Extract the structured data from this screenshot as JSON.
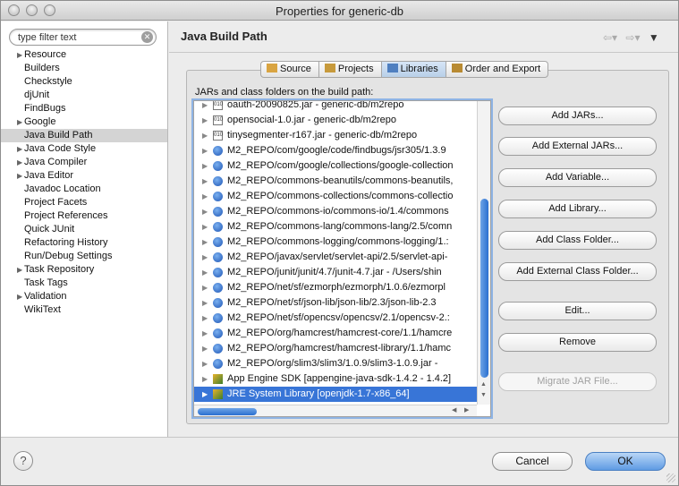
{
  "window": {
    "title": "Properties for generic-db"
  },
  "filter": {
    "placeholder": "type filter text",
    "value": "type filter text"
  },
  "tree": [
    {
      "label": "Resource",
      "expandable": true
    },
    {
      "label": "Builders",
      "expandable": false
    },
    {
      "label": "Checkstyle",
      "expandable": false
    },
    {
      "label": "djUnit",
      "expandable": false
    },
    {
      "label": "FindBugs",
      "expandable": false
    },
    {
      "label": "Google",
      "expandable": true
    },
    {
      "label": "Java Build Path",
      "expandable": false,
      "selected": true
    },
    {
      "label": "Java Code Style",
      "expandable": true
    },
    {
      "label": "Java Compiler",
      "expandable": true
    },
    {
      "label": "Java Editor",
      "expandable": true
    },
    {
      "label": "Javadoc Location",
      "expandable": false
    },
    {
      "label": "Project Facets",
      "expandable": false
    },
    {
      "label": "Project References",
      "expandable": false
    },
    {
      "label": "Quick JUnit",
      "expandable": false
    },
    {
      "label": "Refactoring History",
      "expandable": false
    },
    {
      "label": "Run/Debug Settings",
      "expandable": false
    },
    {
      "label": "Task Repository",
      "expandable": true
    },
    {
      "label": "Task Tags",
      "expandable": false
    },
    {
      "label": "Validation",
      "expandable": true
    },
    {
      "label": "WikiText",
      "expandable": false
    }
  ],
  "page": {
    "title": "Java Build Path"
  },
  "tabs": [
    {
      "label": "Source",
      "icon": "source-folder-icon"
    },
    {
      "label": "Projects",
      "icon": "projects-icon"
    },
    {
      "label": "Libraries",
      "icon": "libraries-icon",
      "active": true
    },
    {
      "label": "Order and Export",
      "icon": "order-export-icon"
    }
  ],
  "libraries": {
    "label": "JARs and class folders on the build path:",
    "items": [
      {
        "text": "oauth-20090825.jar - generic-db/m2repo",
        "icon": "jar"
      },
      {
        "text": "opensocial-1.0.jar - generic-db/m2repo",
        "icon": "jar"
      },
      {
        "text": "tinysegmenter-r167.jar - generic-db/m2repo",
        "icon": "jar"
      },
      {
        "text": "M2_REPO/com/google/code/findbugs/jsr305/1.3.9",
        "icon": "lib"
      },
      {
        "text": "M2_REPO/com/google/collections/google-collection",
        "icon": "lib"
      },
      {
        "text": "M2_REPO/commons-beanutils/commons-beanutils,",
        "icon": "lib"
      },
      {
        "text": "M2_REPO/commons-collections/commons-collectio",
        "icon": "lib"
      },
      {
        "text": "M2_REPO/commons-io/commons-io/1.4/commons",
        "icon": "lib"
      },
      {
        "text": "M2_REPO/commons-lang/commons-lang/2.5/comn",
        "icon": "lib"
      },
      {
        "text": "M2_REPO/commons-logging/commons-logging/1.:",
        "icon": "lib"
      },
      {
        "text": "M2_REPO/javax/servlet/servlet-api/2.5/servlet-api-",
        "icon": "lib"
      },
      {
        "text": "M2_REPO/junit/junit/4.7/junit-4.7.jar - /Users/shin",
        "icon": "lib"
      },
      {
        "text": "M2_REPO/net/sf/ezmorph/ezmorph/1.0.6/ezmorpl",
        "icon": "lib"
      },
      {
        "text": "M2_REPO/net/sf/json-lib/json-lib/2.3/json-lib-2.3",
        "icon": "lib"
      },
      {
        "text": "M2_REPO/net/sf/opencsv/opencsv/2.1/opencsv-2.:",
        "icon": "lib"
      },
      {
        "text": "M2_REPO/org/hamcrest/hamcrest-core/1.1/hamcre",
        "icon": "lib"
      },
      {
        "text": "M2_REPO/org/hamcrest/hamcrest-library/1.1/hamc",
        "icon": "lib"
      },
      {
        "text": "M2_REPO/org/slim3/slim3/1.0.9/slim3-1.0.9.jar -",
        "icon": "lib"
      },
      {
        "text": "App Engine SDK [appengine-java-sdk-1.4.2 - 1.4.2]",
        "icon": "sdk"
      },
      {
        "text": "JRE System Library [openjdk-1.7-x86_64]",
        "icon": "sdk",
        "selected": true
      }
    ]
  },
  "buttons": {
    "add_jars": "Add JARs...",
    "add_external_jars": "Add External JARs...",
    "add_variable": "Add Variable...",
    "add_library": "Add Library...",
    "add_class_folder": "Add Class Folder...",
    "add_external_class_folder": "Add External Class Folder...",
    "edit": "Edit...",
    "remove": "Remove",
    "migrate_jar": "Migrate JAR File..."
  },
  "footer": {
    "help": "?",
    "cancel": "Cancel",
    "ok": "OK"
  },
  "colors": {
    "selection": "#3875d7",
    "tab_active": "#b8cfe8",
    "ok_button": "#5f9be4"
  }
}
